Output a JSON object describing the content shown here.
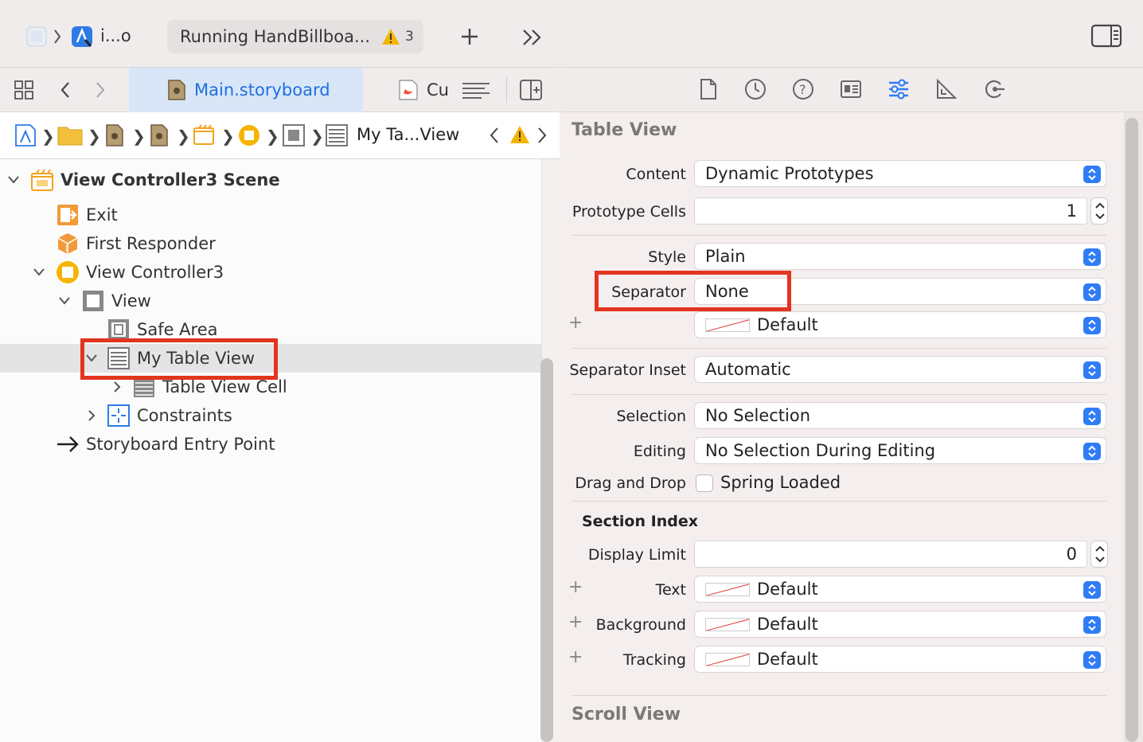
{
  "toolbar": {
    "scheme_label": "i...o",
    "run_status": "Running HandBillboa...",
    "warning_count": "3"
  },
  "tabs": {
    "main": "Main.storyboard",
    "other": "Cu"
  },
  "jumpbar": {
    "label": "My Ta...View"
  },
  "outline": {
    "scene": "View Controller3 Scene",
    "exit": "Exit",
    "first_responder": "First Responder",
    "view_controller": "View Controller3",
    "view": "View",
    "safe_area": "Safe Area",
    "table_view": "My Table View",
    "table_cell": "Table View Cell",
    "constraints": "Constraints",
    "entry_point": "Storyboard Entry Point"
  },
  "inspector": {
    "section_table": "Table View",
    "content_label": "Content",
    "content_value": "Dynamic Prototypes",
    "prototype_label": "Prototype Cells",
    "prototype_value": "1",
    "style_label": "Style",
    "style_value": "Plain",
    "separator_label": "Separator",
    "separator_value": "None",
    "separator_color": "Default",
    "inset_label": "Separator Inset",
    "inset_value": "Automatic",
    "selection_label": "Selection",
    "selection_value": "No Selection",
    "editing_label": "Editing",
    "editing_value": "No Selection During Editing",
    "dragdrop_label": "Drag and Drop",
    "dragdrop_value": "Spring Loaded",
    "section_index": "Section Index",
    "display_limit_label": "Display Limit",
    "display_limit_value": "0",
    "text_label": "Text",
    "text_value": "Default",
    "background_label": "Background",
    "background_value": "Default",
    "tracking_label": "Tracking",
    "tracking_value": "Default",
    "section_scroll": "Scroll View"
  },
  "colors": {
    "accent": "#2f7cf6",
    "highlight": "#e3341f",
    "warning": "#f4b400"
  }
}
